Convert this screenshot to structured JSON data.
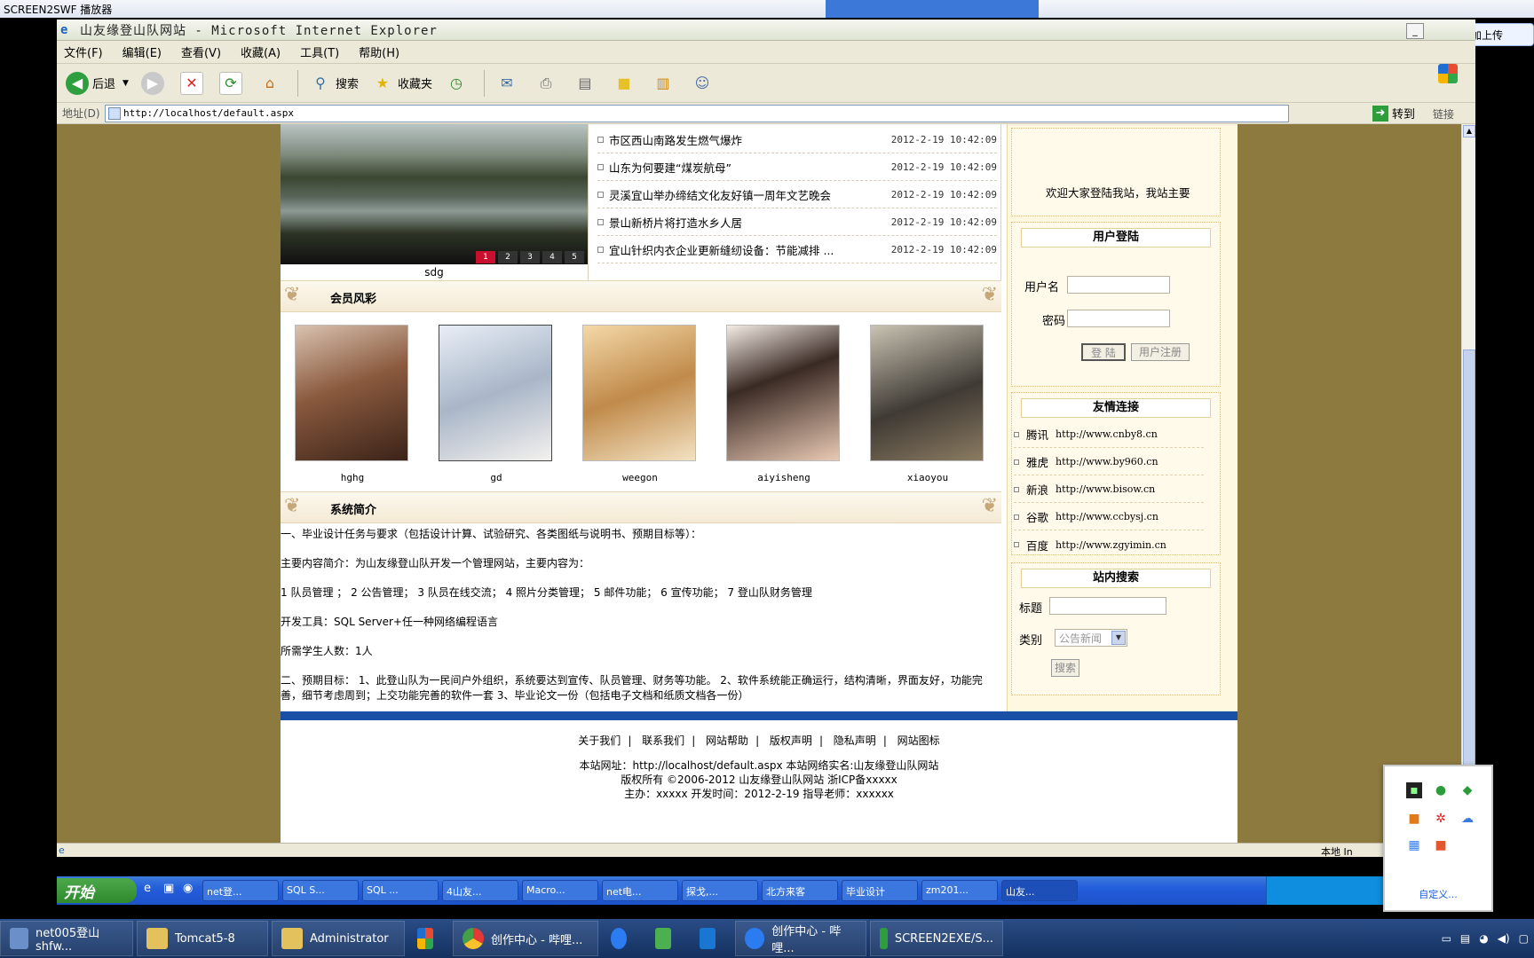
{
  "outer_title": "SCREEN2SWF 播放器",
  "ie": {
    "title": "山友缘登山队网站 - Microsoft Internet Explorer",
    "menu": [
      "文件(F)",
      "编辑(E)",
      "查看(V)",
      "收藏(A)",
      "工具(T)",
      "帮助(H)"
    ],
    "toolbar": {
      "back": "后退",
      "search": "搜索",
      "favorites": "收藏夹"
    },
    "address_label": "地址(D)",
    "address": "http://localhost/default.aspx",
    "go": "转到",
    "links": "链接"
  },
  "cloud_upload": "添加上传",
  "slider": {
    "caption": "sdg",
    "pages": [
      "1",
      "2",
      "3",
      "4",
      "5"
    ],
    "active_page": "1"
  },
  "news": [
    {
      "title": "市区西山南路发生燃气爆炸",
      "date": "2012-2-19 10:42:09"
    },
    {
      "title": "山东为何要建“煤炭航母”",
      "date": "2012-2-19 10:42:09"
    },
    {
      "title": "灵溪宜山举办缔结文化友好镇一周年文艺晚会",
      "date": "2012-2-19 10:42:09"
    },
    {
      "title": "景山新桥片将打造水乡人居",
      "date": "2012-2-19 10:42:09"
    },
    {
      "title": "宜山针织内衣企业更新缝纫设备：节能减排 ...",
      "date": "2012-2-19 10:42:09"
    }
  ],
  "members": {
    "title": "会员风彩",
    "items": [
      "hghg",
      "gd",
      "weegon",
      "aiyisheng",
      "xiaoyou"
    ]
  },
  "intro": {
    "title": "系统简介",
    "paragraphs": [
      "一、毕业设计任务与要求（包括设计计算、试验研究、各类图纸与说明书、预期目标等）：",
      "主要内容简介：为山友缘登山队开发一个管理网站，主要内容为：",
      "1 队员管理 ； 2 公告管理； 3 队员在线交流； 4 照片分类管理； 5 邮件功能； 6 宣传功能； 7 登山队财务管理",
      "开发工具：SQL Server+任一种网络编程语言",
      "所需学生人数：1人",
      "二、预期目标： 1、此登山队为一民间户外组织，系统要达到宣传、队员管理、财务等功能。 2、软件系统能正确运行，结构清晰，界面友好，功能完善，细节考虑周到；上交功能完善的软件一套 3、毕业论文一份（包括电子文档和纸质文档各一份）"
    ]
  },
  "sidebar": {
    "welcome": "欢迎大家登陆我站，我站主要",
    "login": {
      "title": "用户登陆",
      "username_label": "用户名",
      "password_label": "密码",
      "login_button": "登 陆",
      "register_button": "用户注册"
    },
    "friend_links": {
      "title": "友情连接",
      "items": [
        {
          "name": "腾讯",
          "url": "http://www.cnby8.cn"
        },
        {
          "name": "雅虎",
          "url": "http://www.by960.cn"
        },
        {
          "name": "新浪",
          "url": "http://www.bisow.cn"
        },
        {
          "name": "谷歌",
          "url": "http://www.ccbysj.cn"
        },
        {
          "name": "百度",
          "url": "http://www.zgyimin.cn"
        }
      ]
    },
    "search": {
      "title": "站内搜索",
      "title_label": "标题",
      "category_label": "类别",
      "category_value": "公告新闻",
      "search_button": "搜索"
    }
  },
  "footer": {
    "nav": [
      "关于我们",
      "联系我们",
      "网站帮助",
      "版权声明",
      "隐私声明",
      "网站图标"
    ],
    "line1": "本站网址：http://localhost/default.aspx  本站网络实名:山友缘登山队网站",
    "line2": "版权所有 ©2006-2012 山友缘登山队网站  浙ICP备xxxxx",
    "line3": "主办：xxxxx  开发时间：2012-2-19  指导老师：xxxxxx"
  },
  "status": {
    "zone": "本地 In"
  },
  "xp_taskbar": {
    "start": "开始",
    "tasks": [
      "net登...",
      "SQL S...",
      "SQL ...",
      "4山友...",
      "Macro...",
      "net电...",
      "探戈,...",
      "北方来客",
      "毕业设计",
      "zm201...",
      "山友..."
    ]
  },
  "tray_popup": {
    "customize": "自定义..."
  },
  "host_taskbar": {
    "items": [
      "net005登山shfw...",
      "Tomcat5-8",
      "Administrator",
      "",
      "创作中心 - 哔哩...",
      "",
      "",
      "",
      "创作中心 - 哔哩...",
      "SCREEN2EXE/S..."
    ]
  },
  "colors": {
    "page_bg": "#8d7a3f",
    "footer_line": "#1a4fa6",
    "xp_blue": "#245edc"
  }
}
